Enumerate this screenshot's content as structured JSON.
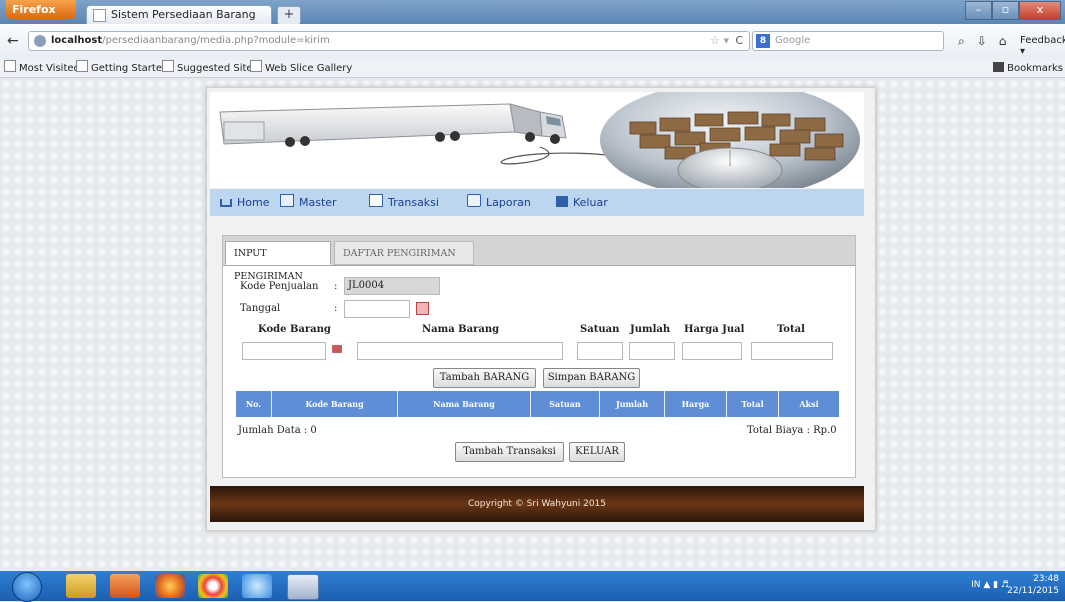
{
  "window": {
    "app_button": "Firefox",
    "tab_title": "Sistem Persediaan Barang",
    "new_tab": "+",
    "min": "–",
    "max": "▫",
    "close": "x"
  },
  "nav": {
    "url_host": "localhost",
    "url_path": "/persediaanbarang/media.php?module=kirim",
    "search_placeholder": "Google",
    "search_engine": "8",
    "feedback": "Feedback"
  },
  "bookmarks": {
    "items": [
      "Most Visited",
      "Getting Started",
      "Suggested Sites",
      "Web Slice Gallery"
    ],
    "right": "Bookmarks"
  },
  "menu": {
    "home": "Home",
    "master": "Master",
    "transaksi": "Transaksi",
    "laporan": "Laporan",
    "keluar": "Keluar"
  },
  "form": {
    "tabs": [
      "INPUT PENGIRIMAN",
      "DAFTAR PENGIRIMAN"
    ],
    "kode_penjualan_label": "Kode Penjualan",
    "kode_penjualan_value": "JL0004",
    "tanggal_label": "Tanggal",
    "colon": ":",
    "headers": {
      "kode_barang": "Kode Barang",
      "nama_barang": "Nama Barang",
      "satuan": "Satuan",
      "jumlah": "Jumlah",
      "harga_jual": "Harga Jual",
      "total": "Total"
    },
    "tambah_barang": "Tambah BARANG",
    "simpan_barang": "Simpan BARANG",
    "table_columns": [
      "No.",
      "Kode Barang",
      "Nama Barang",
      "Satuan",
      "Jumlah",
      "Harga",
      "Total",
      "Aksi"
    ],
    "jumlah_data": "Jumlah Data : 0",
    "total_biaya": "Total Biaya : Rp.0",
    "tambah_transaksi": "Tambah Transaksi",
    "keluar_btn": "KELUAR"
  },
  "footer": {
    "copyright": "Copyright © Sri Wahyuni 2015"
  },
  "taskbar": {
    "lang": "IN",
    "time": "23:48",
    "date": "22/11/2015"
  }
}
